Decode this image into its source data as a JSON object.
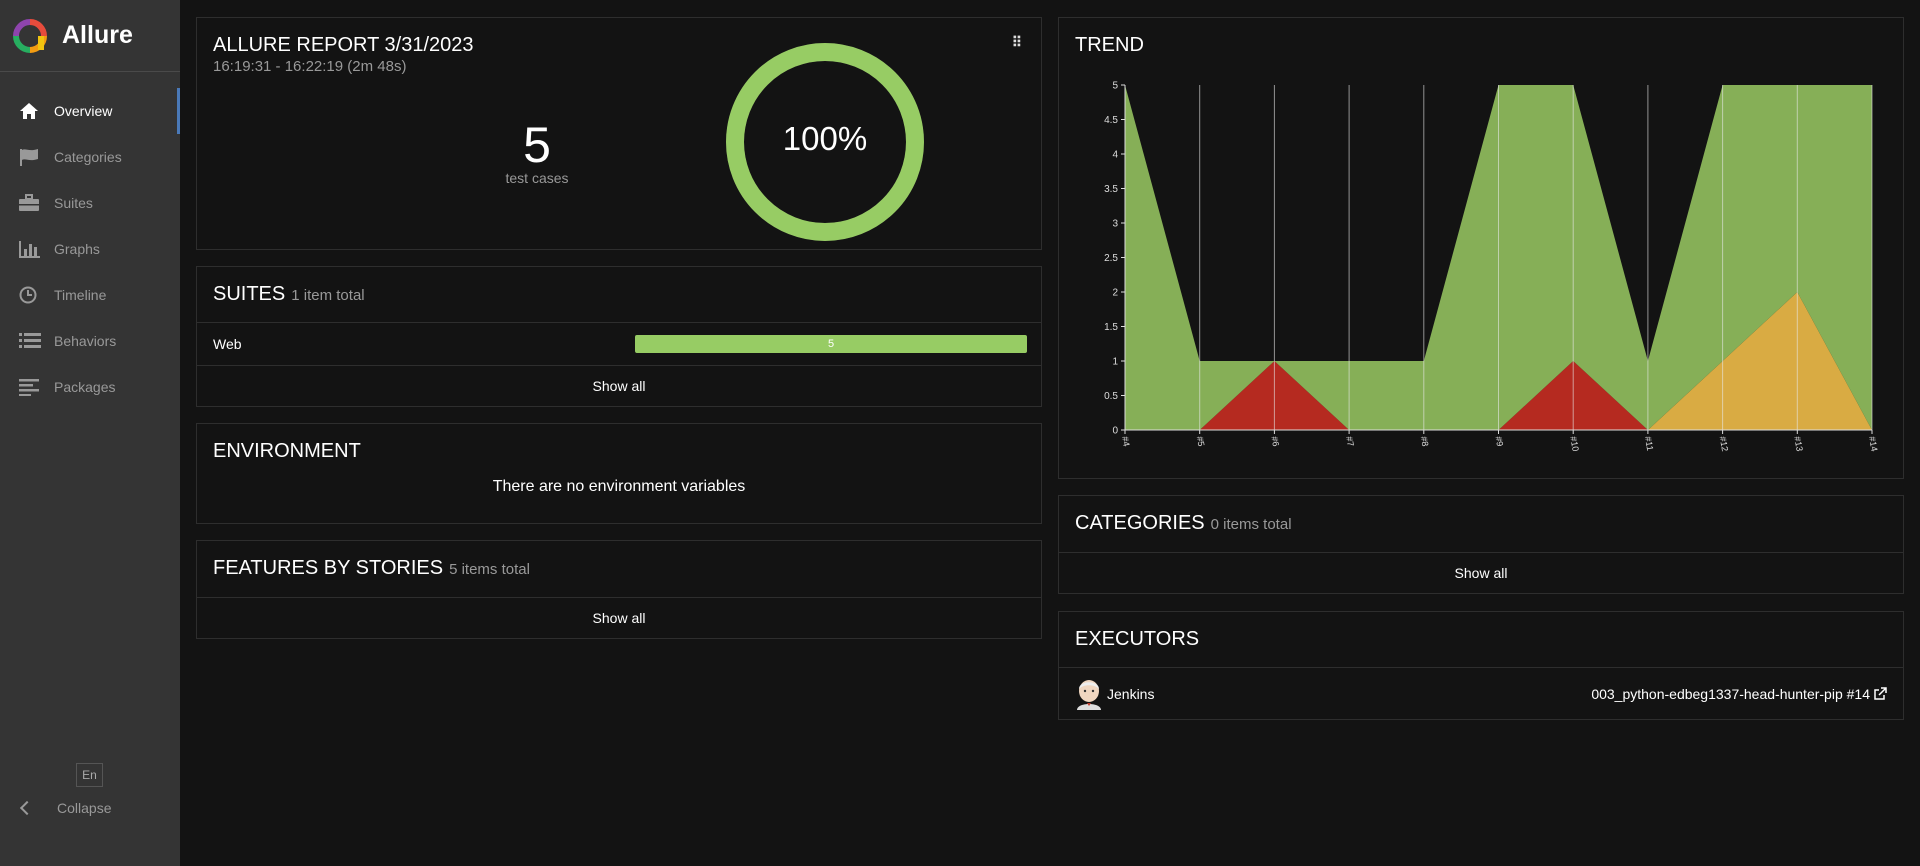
{
  "app": {
    "name": "Allure"
  },
  "sidebar": {
    "items": [
      {
        "label": "Overview",
        "icon": "home-icon",
        "active": true
      },
      {
        "label": "Categories",
        "icon": "flag-icon",
        "active": false
      },
      {
        "label": "Suites",
        "icon": "briefcase-icon",
        "active": false
      },
      {
        "label": "Graphs",
        "icon": "bar-chart-icon",
        "active": false
      },
      {
        "label": "Timeline",
        "icon": "clock-icon",
        "active": false
      },
      {
        "label": "Behaviors",
        "icon": "list-icon",
        "active": false
      },
      {
        "label": "Packages",
        "icon": "align-left-icon",
        "active": false
      }
    ],
    "language": "En",
    "collapse_label": "Collapse"
  },
  "summary": {
    "title": "ALLURE REPORT 3/31/2023",
    "subtitle": "16:19:31 - 16:22:19 (2m 48s)",
    "test_count": "5",
    "test_count_label": "test cases",
    "success_rate": "100%",
    "success_fraction": 1.0
  },
  "suites": {
    "title": "SUITES",
    "subtitle": "1 item total",
    "items": [
      {
        "name": "Web",
        "passed": "5"
      }
    ],
    "show_all": "Show all"
  },
  "environment": {
    "title": "ENVIRONMENT",
    "empty_text": "There are no environment variables"
  },
  "features": {
    "title": "FEATURES BY STORIES",
    "subtitle": "5 items total",
    "show_all": "Show all"
  },
  "trend": {
    "title": "TREND"
  },
  "categories": {
    "title": "CATEGORIES",
    "subtitle": "0 items total",
    "show_all": "Show all"
  },
  "executors": {
    "title": "EXECUTORS",
    "name": "Jenkins",
    "build": "003_python-edbeg1337-head-hunter-pip #14"
  },
  "colors": {
    "passed": "#97cc64",
    "failed": "#fd5a3e",
    "broken": "#ffd050",
    "trend_passed": "#86af57",
    "trend_failed": "#b52a20",
    "trend_broken": "#d9ab43"
  },
  "chart_data": {
    "type": "area",
    "x": [
      "#4",
      "#5",
      "#6",
      "#7",
      "#8",
      "#9",
      "#10",
      "#11",
      "#12",
      "#13",
      "#14"
    ],
    "y_ticks": [
      "0",
      "0.5",
      "1",
      "1.5",
      "2",
      "2.5",
      "3",
      "3.5",
      "4",
      "4.5",
      "5"
    ],
    "ylim": [
      0,
      5
    ],
    "series": [
      {
        "name": "broken",
        "values": [
          0,
          0,
          0,
          0,
          0,
          0,
          0,
          0,
          1,
          2,
          0
        ]
      },
      {
        "name": "failed",
        "values": [
          0,
          0,
          1,
          0,
          0,
          0,
          1,
          0,
          0,
          0,
          0
        ]
      },
      {
        "name": "passed",
        "values": [
          5,
          1,
          0,
          1,
          1,
          5,
          4,
          1,
          4,
          3,
          5
        ]
      }
    ]
  }
}
